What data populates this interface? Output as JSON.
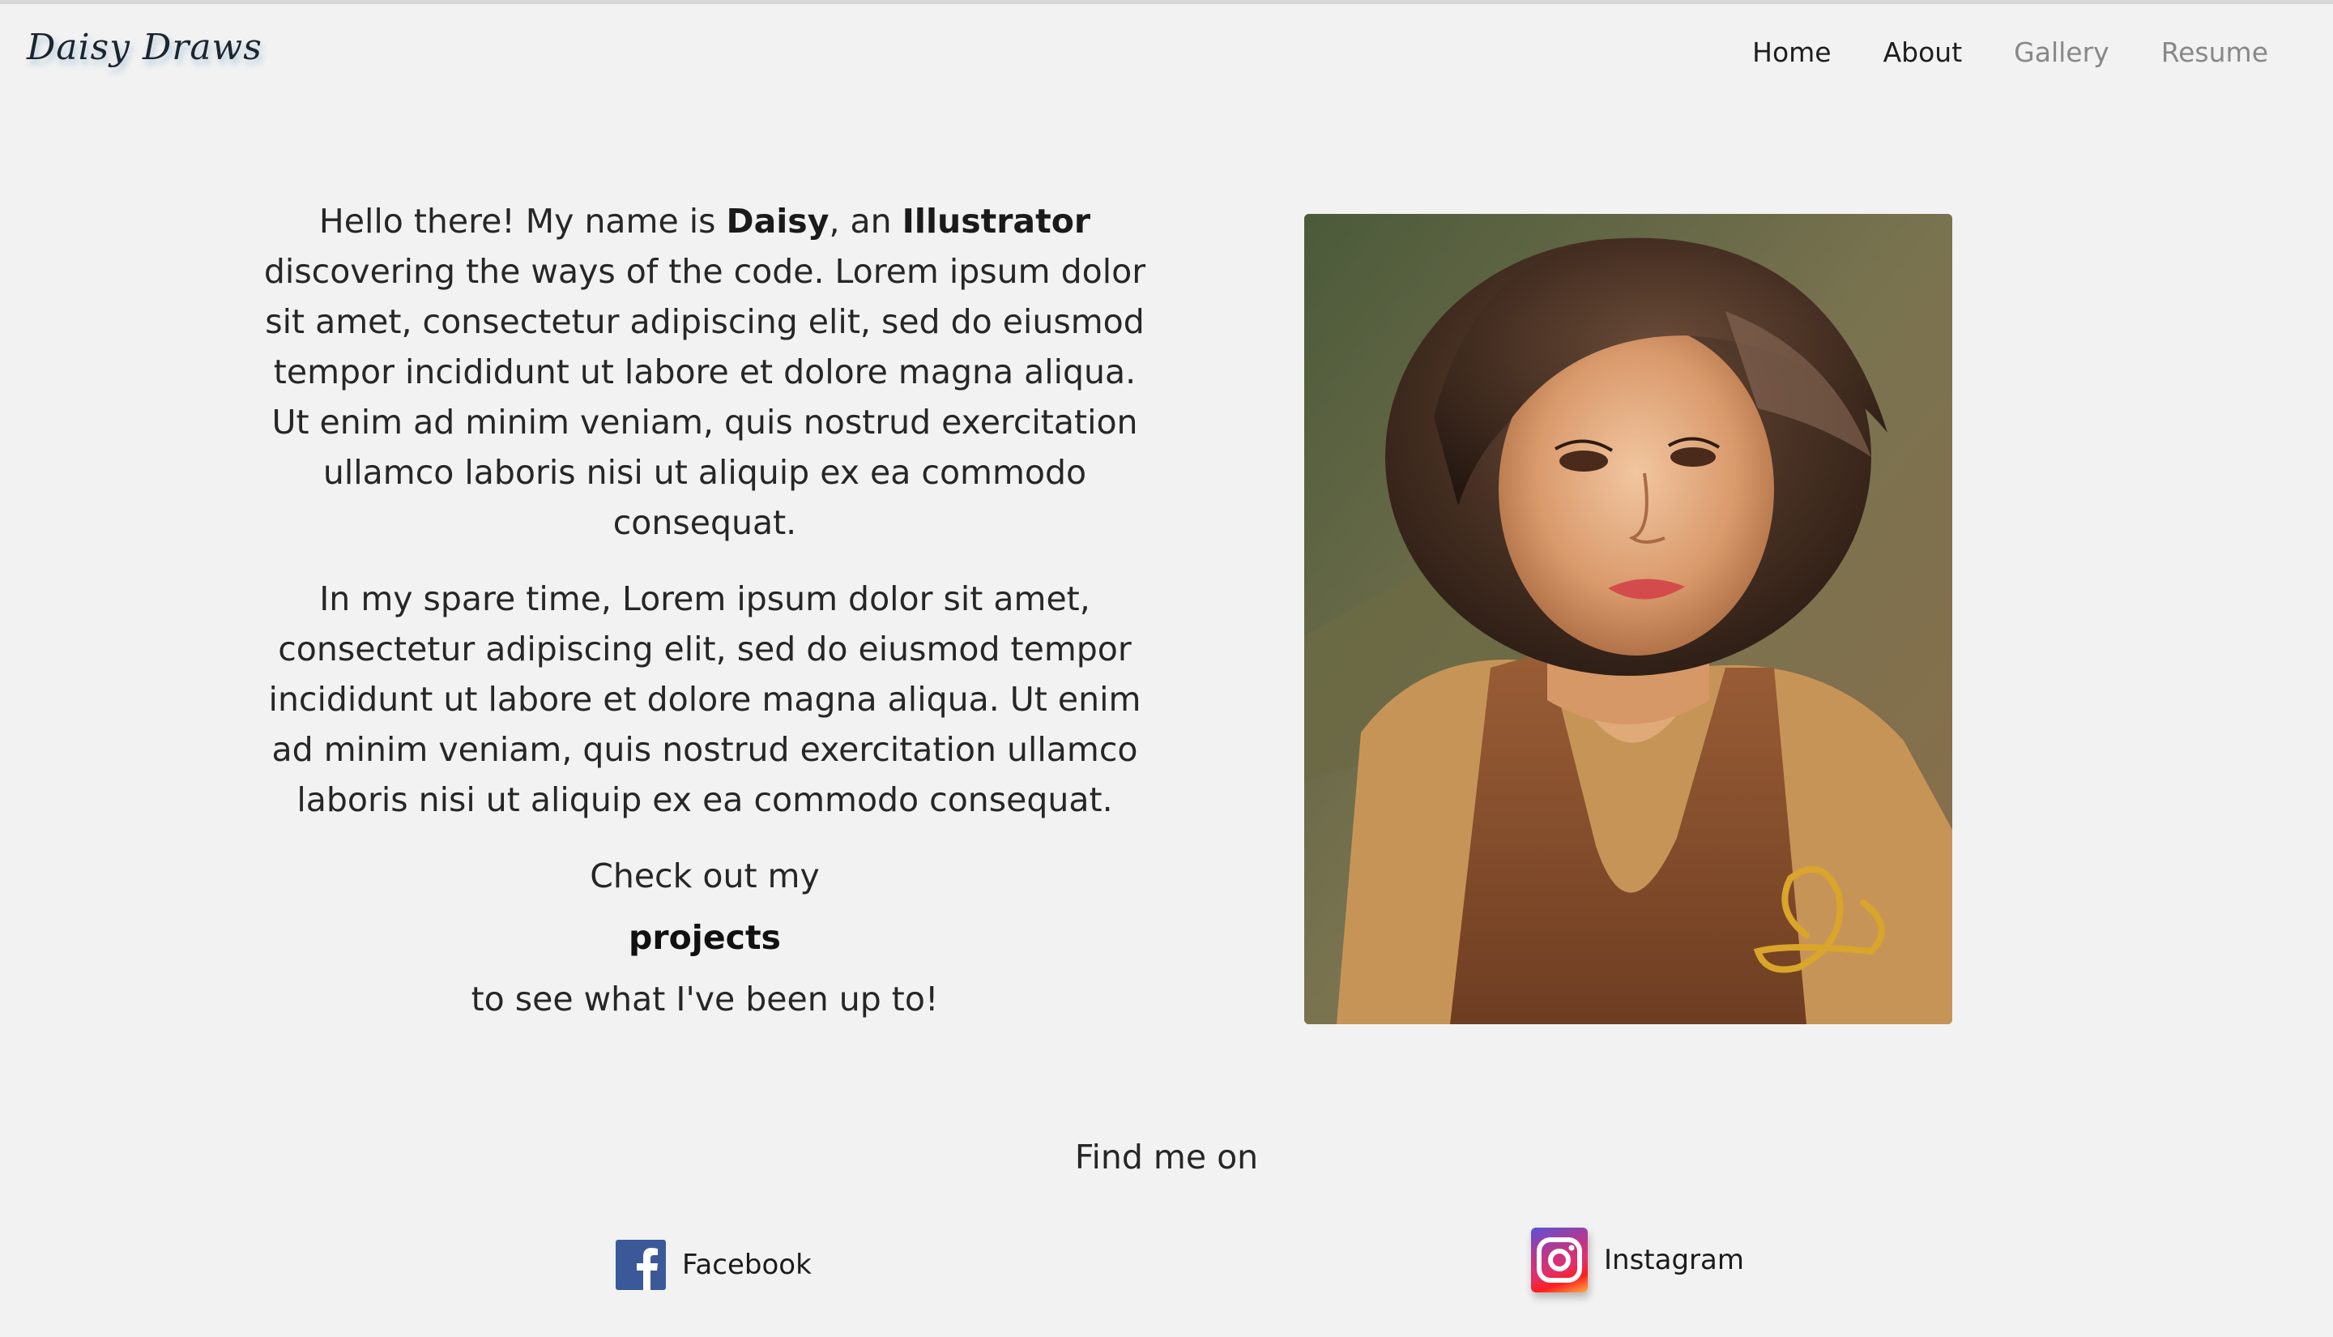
{
  "header": {
    "brand": "Daisy Draws",
    "nav": [
      "Home",
      "About",
      "Gallery",
      "Resume"
    ]
  },
  "intro": {
    "p1_start": "Hello there! My name is ",
    "p1_name": "Daisy",
    "p1_mid": ", an ",
    "p1_role": "Illustrator",
    "p1_rest": " discovering the ways of the code. Lorem ipsum dolor sit amet, consectetur adipiscing elit, sed do eiusmod tempor incididunt ut labore et dolore magna aliqua. Ut enim ad minim veniam, quis nostrud exercitation ullamco laboris nisi ut aliquip ex ea commodo consequat.",
    "p2": "In my spare time, Lorem ipsum dolor sit amet, consectetur adipiscing elit, sed do eiusmod tempor incididunt ut labore et dolore magna aliqua. Ut enim ad minim veniam, quis nostrud exercitation ullamco laboris nisi ut aliquip ex ea commodo consequat.",
    "cta_before": "Check out my",
    "cta_link": "projects",
    "cta_after": "to see what I've been up to!"
  },
  "social": {
    "title": "Find me on",
    "facebook_label": "Facebook",
    "facebook_icon": "facebook-icon",
    "instagram_label": "Instagram",
    "instagram_icon": "instagram-icon"
  },
  "colors": {
    "background": "#f2f2f2",
    "facebook": "#3b5998"
  }
}
